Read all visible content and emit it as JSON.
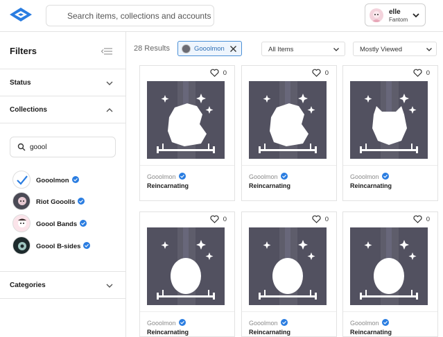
{
  "header": {
    "search_placeholder": "Search items, collections and accounts",
    "account": {
      "name": "elle",
      "network": "Fantom"
    }
  },
  "sidebar": {
    "title": "Filters",
    "sections": {
      "status": "Status",
      "collections": "Collections",
      "categories": "Categories"
    },
    "collection_search_value": "goool",
    "collections": [
      {
        "name": "Gooolmon",
        "verified": true,
        "selected": true
      },
      {
        "name": "Riot Gooolls",
        "verified": true,
        "selected": false
      },
      {
        "name": "Goool Bands",
        "verified": true,
        "selected": false
      },
      {
        "name": "Goool B-sides",
        "verified": true,
        "selected": false
      }
    ]
  },
  "toolbar": {
    "results": "28 Results",
    "active_filter": "Gooolmon",
    "items_dropdown": "All Items",
    "sort_dropdown": "Mostly Viewed"
  },
  "cards": [
    {
      "likes": "0",
      "collection": "Gooolmon",
      "title": "Reincarnating",
      "art": "blob"
    },
    {
      "likes": "0",
      "collection": "Gooolmon",
      "title": "Reincarnating",
      "art": "blob"
    },
    {
      "likes": "0",
      "collection": "Gooolmon",
      "title": "Reincarnating",
      "art": "cat"
    },
    {
      "likes": "0",
      "collection": "Gooolmon",
      "title": "Reincarnating",
      "art": "egg"
    },
    {
      "likes": "0",
      "collection": "Gooolmon",
      "title": "Reincarnating",
      "art": "egg"
    },
    {
      "likes": "0",
      "collection": "Gooolmon",
      "title": "Reincarnating",
      "art": "egg"
    }
  ],
  "colors": {
    "accent": "#2e6fb5",
    "verified": "#2a7de1",
    "art_bg": "#525160"
  },
  "icons": [
    "logo-icon",
    "chevron-down-icon",
    "chevron-up-icon",
    "collapse-filters-icon",
    "search-icon",
    "verified-icon",
    "check-icon",
    "close-icon",
    "heart-icon"
  ]
}
